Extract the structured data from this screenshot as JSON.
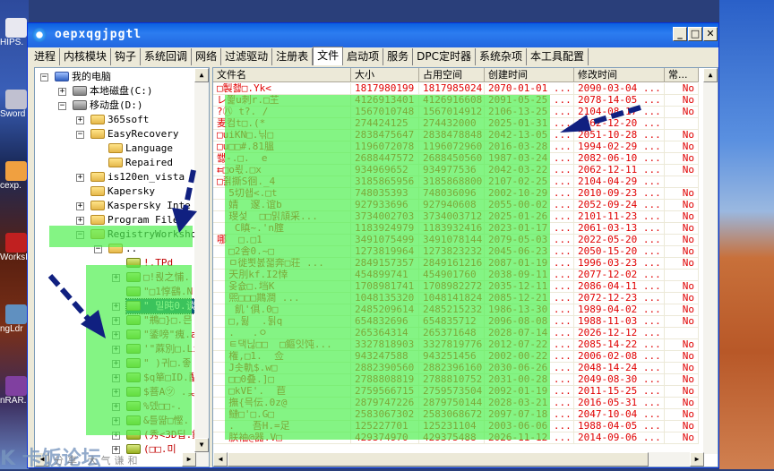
{
  "desktop": {
    "icons": [
      "HIPS.",
      "Sword",
      "cexp.",
      "WorksI",
      "ngLdr",
      "nRAR."
    ],
    "watermark": "卡饭论坛",
    "watermark_sub": "分享 大气谦和"
  },
  "window": {
    "title": "oepxqgjpgtl",
    "minimize": "_",
    "maximize": "□",
    "close": "✕"
  },
  "tabs": [
    "进程",
    "内核模块",
    "钩子",
    "系统回调",
    "网络",
    "过滤驱动",
    "注册表",
    "文件",
    "启动项",
    "服务",
    "DPC定时器",
    "系统杂项",
    "本工具配置"
  ],
  "active_tab": "文件",
  "tree": [
    {
      "label": "我的电脑",
      "level": 0,
      "exp": "-",
      "icon": "computer"
    },
    {
      "label": "本地磁盘(C:)",
      "level": 1,
      "exp": "+",
      "icon": "drive"
    },
    {
      "label": "移动盘(D:)",
      "level": 1,
      "exp": "-",
      "icon": "drive"
    },
    {
      "label": "365soft",
      "level": 2,
      "exp": "+"
    },
    {
      "label": "EasyRecovery",
      "level": 2,
      "exp": "-"
    },
    {
      "label": "Language",
      "level": 3,
      "exp": ""
    },
    {
      "label": "Repaired",
      "level": 3,
      "exp": ""
    },
    {
      "label": "is120en_vista",
      "level": 2,
      "exp": "+"
    },
    {
      "label": "Kapersky",
      "level": 2,
      "exp": ""
    },
    {
      "label": "Kaspersky Inte",
      "level": 2,
      "exp": "+"
    },
    {
      "label": "Program Files",
      "level": 2,
      "exp": "+"
    },
    {
      "label": "RegistryWorkshop-",
      "level": 2,
      "exp": "-"
    },
    {
      "label": "..",
      "level": 3,
      "exp": "-"
    },
    {
      "label": "!.TPd",
      "level": 4,
      "exp": "",
      "red": true
    },
    {
      "label": "□!뢵之悑.",
      "level": 4,
      "exp": "+",
      "red": true
    },
    {
      "label": "\"□1惇鷂.N",
      "level": 4,
      "exp": "",
      "red": true
    },
    {
      "label": "\" 밀旽0.谈",
      "level": 4,
      "exp": "+",
      "selected": true
    },
    {
      "label": "\"鵧□}□.믄",
      "level": 4,
      "exp": "+",
      "red": true
    },
    {
      "label": "\"鋈嗙\"瘣.a'",
      "level": 4,
      "exp": "+",
      "red": true
    },
    {
      "label": "'\"蔴別□.Li",
      "level": 4,
      "exp": "+",
      "red": true
    },
    {
      "label": "\" )귀□.좋",
      "level": 4,
      "exp": "+",
      "red": true
    },
    {
      "label": "$q箪□ID.酟",
      "level": 4,
      "exp": "+",
      "red": true
    },
    {
      "label": "$菩A㋡ .ᆽ",
      "level": 4,
      "exp": "+",
      "red": true
    },
    {
      "label": "%뎄□□-.",
      "level": 4,
      "exp": "+",
      "red": true
    },
    {
      "label": "&틀땲□慳.",
      "level": 4,
      "exp": "+",
      "red": true
    },
    {
      "label": "(秀<3D딥.鏁",
      "level": 4,
      "exp": "+",
      "red": true
    },
    {
      "label": "(□□.미",
      "level": 4,
      "exp": "+",
      "red": true
    }
  ],
  "columns": [
    "文件名",
    "大小",
    "占用空间",
    "创建时间",
    "修改时间",
    "常..."
  ],
  "rows": [
    [
      "□製쵏□.Yk<",
      "1817980199",
      "1817985024",
      "2070-01-01 ...",
      "2090-03-04 ...",
      "No"
    ],
    [
      "レ쬝u刺r.□芏",
      "4126913401",
      "4126916608",
      "2091-05-25 ...",
      "2078-14-05 ...",
      "No"
    ],
    [
      "?㊇ t?. /",
      "1567010748",
      "1567014912",
      "2106-13-25 ...",
      "2104-08-17 ...",
      "No"
    ],
    [
      "麦컴t□.(*",
      "274424125",
      "274432000",
      "2025-01-31 ...",
      "2062-12-20 ...",
      ""
    ],
    [
      "□uiKN□.닊□",
      "2838475647",
      "2838478848",
      "2042-13-05 ...",
      "2051-10-28 ...",
      "No"
    ],
    [
      "□u□□#.81膃",
      "1196072078",
      "1196072960",
      "2016-03-28 ...",
      "1994-02-29 ...",
      "No"
    ],
    [
      "쐟-.□.  e",
      "2688447572",
      "2688450560",
      "1987-03-24 ...",
      "2082-06-10 ...",
      "No"
    ],
    [
      "⇇□o뢳.□x",
      "934969652",
      "934977536",
      "2042-03-22 ...",
      "2062-12-11 ...",
      "No"
    ],
    [
      "□쥙撕S徊._4",
      "3185865956",
      "3185868800",
      "2107-02-25 ...",
      "2104-04-29 ...",
      ""
    ],
    [
      "  5切쇕<.□t",
      "748035393",
      "748036096",
      "2002-10-29 ...",
      "2010-09-23 ...",
      "No"
    ],
    [
      "  婧  邃.谊b",
      "927933696",
      "927940608",
      "2055-00-02 ...",
      "2052-09-24 ...",
      "No"
    ],
    [
      "  琝섳  □□밁頏采...",
      "3734002703",
      "3734003712",
      "2025-01-26 ...",
      "2101-11-23 ...",
      "No"
    ],
    [
      "   C瞋~.'n腟",
      "1183924979",
      "1183932416",
      "2023-01-17 ...",
      "2061-03-13 ...",
      "No"
    ],
    [
      "哪  □.□1",
      "3491075499",
      "3491078144",
      "2079-05-03 ...",
      "2022-05-20 ...",
      "No"
    ],
    [
      "  □2舎0.~□",
      "1273819964",
      "1273823232",
      "2045-06-23 ...",
      "2050-15-20 ...",
      "No"
    ],
    [
      "  ㅁ徙뾧봀잷奔□荘 ...",
      "2849157357",
      "2849161216",
      "2087-01-19 ...",
      "1996-03-23 ...",
      "No"
    ],
    [
      "  天刖kf.I2悻",
      "454899741",
      "454901760",
      "2038-09-11 ...",
      "2077-12-02 ...",
      ""
    ],
    [
      "  옺슚□.垱K",
      "1708981741",
      "1708982272",
      "2035-12-11 ...",
      "2086-04-11 ...",
      "No"
    ],
    [
      "  煕□□□䳢澗 ...",
      "1048135320",
      "1048141824",
      "2085-12-21 ...",
      "2072-12-23 ...",
      "No"
    ],
    [
      "   飢'俱.0□",
      "2485209614",
      "2485215232",
      "1986-13-30 ...",
      "1989-04-02 ...",
      "No"
    ],
    [
      "  □,뒳  .뒭q",
      "654832696",
      "654835712",
      "2096-08-08 ...",
      "1988-11-03 ...",
      "No"
    ],
    [
      "  .   .ㅇ",
      "265364314",
      "265371648",
      "2028-07-14 ...",
      "2026-12-12 ...",
      ""
    ],
    [
      "  ㅌ댁닎□□  □鏂잇饨...",
      "3327818903",
      "3327819776",
      "2012-07-22 ...",
      "2085-14-22 ...",
      "No"
    ],
    [
      "  権,□1.  佥",
      "943247588",
      "943251456",
      "2002-00-22 ...",
      "2006-02-08 ...",
      "No"
    ],
    [
      "  J솟軌$.w□",
      "2882390560",
      "2882396160",
      "2030-06-26 ...",
      "2048-14-24 ...",
      "No"
    ],
    [
      "  □□0叠.]□",
      "2788808819",
      "2788810752",
      "2031-00-28 ...",
      "2049-08-30 ...",
      "No"
    ],
    [
      "  □kVE'.  苣",
      "2759566715",
      "2759573504",
      "2092-01-19 ...",
      "2011-15-25 ...",
      "No"
    ],
    [
      "  撫{믁伝.0z@",
      "2879747226",
      "2879750144",
      "2028-03-21 ...",
      "2016-05-31 ...",
      "No"
    ],
    [
      "  鰱□'□.G□",
      "2583067302",
      "2583068672",
      "2097-07-18 ...",
      "2047-10-04 ...",
      "No"
    ],
    [
      "  .   吾H.=足",
      "125227701",
      "125231104",
      "2003-06-06 ...",
      "1988-04-05 ...",
      "No"
    ],
    [
      "  朕袖@器.V□",
      "429374970",
      "429375488",
      "2026-11-12 ...",
      "2014-09-06 ...",
      "No"
    ]
  ],
  "colors": {
    "highlight": "#80f080",
    "text_red": "#e00000",
    "arrow": "#102080",
    "titlebar": "#0a5fe0"
  }
}
